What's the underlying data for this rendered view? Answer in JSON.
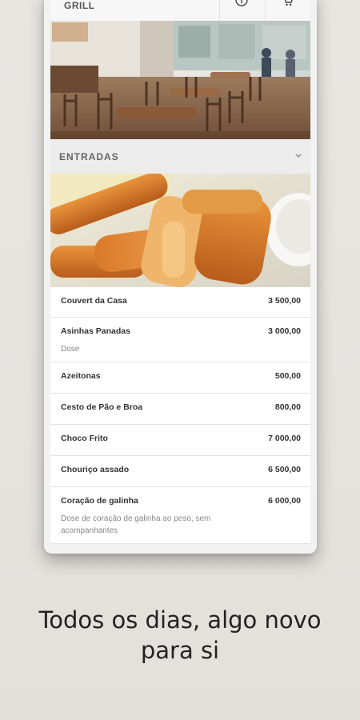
{
  "app": {
    "brand": "GRILL"
  },
  "section": {
    "title": "ENTRADAS"
  },
  "menu": [
    {
      "name": "Couvert da Casa",
      "price": "3 500,00",
      "desc": ""
    },
    {
      "name": "Asinhas Panadas",
      "price": "3 000,00",
      "desc": "Dose"
    },
    {
      "name": "Azeitonas",
      "price": "500,00",
      "desc": ""
    },
    {
      "name": "Cesto de Pão e Broa",
      "price": "800,00",
      "desc": ""
    },
    {
      "name": "Choco Frito",
      "price": "7 000,00",
      "desc": ""
    },
    {
      "name": "Chouriço assado",
      "price": "6 500,00",
      "desc": ""
    },
    {
      "name": "Coração de galinha",
      "price": "6 000,00",
      "desc": "Dose de coração de galinha ao peso, sem acompanhantes"
    }
  ],
  "tagline": {
    "line1": "Todos os dias, algo novo",
    "line2": "para si"
  },
  "icons": {
    "info": "info-icon",
    "cart": "cart-icon",
    "chevron": "chevron-down-icon"
  },
  "colors": {
    "background": "#e8e5e1",
    "text_dark": "#333333",
    "text_muted": "#888888"
  }
}
